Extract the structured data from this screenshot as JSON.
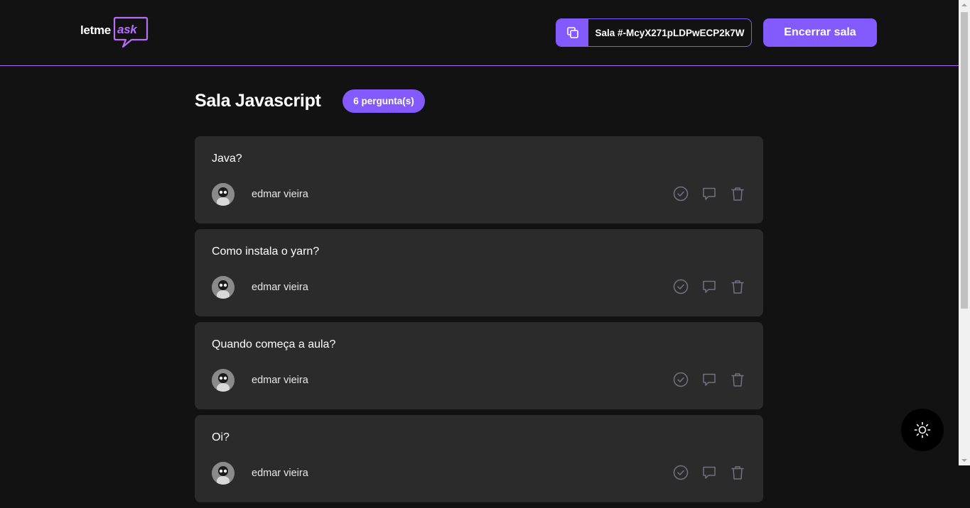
{
  "header": {
    "logo": {
      "part1": "letme",
      "part2": "ask"
    },
    "room_code": {
      "text": "Sala #-McyX271pLDPwECP2k7W"
    },
    "end_room_label": "Encerrar sala"
  },
  "room": {
    "title": "Sala Javascript",
    "question_count": "6 pergunta(s)"
  },
  "questions": [
    {
      "content": "Java?",
      "author": "edmar vieira"
    },
    {
      "content": "Como instala o yarn?",
      "author": "edmar vieira"
    },
    {
      "content": "Quando começa a aula?",
      "author": "edmar vieira"
    },
    {
      "content": "Oi?",
      "author": "edmar vieira"
    }
  ],
  "colors": {
    "accent": "#835afd",
    "background": "#121212",
    "card": "#2b2b2b",
    "header_border": "#b067f0",
    "icon": "#737380"
  },
  "icons": {
    "copy": "copy-icon",
    "check": "check-circle-icon",
    "answer": "chat-bubble-icon",
    "delete": "trash-icon",
    "theme": "sun-icon"
  }
}
